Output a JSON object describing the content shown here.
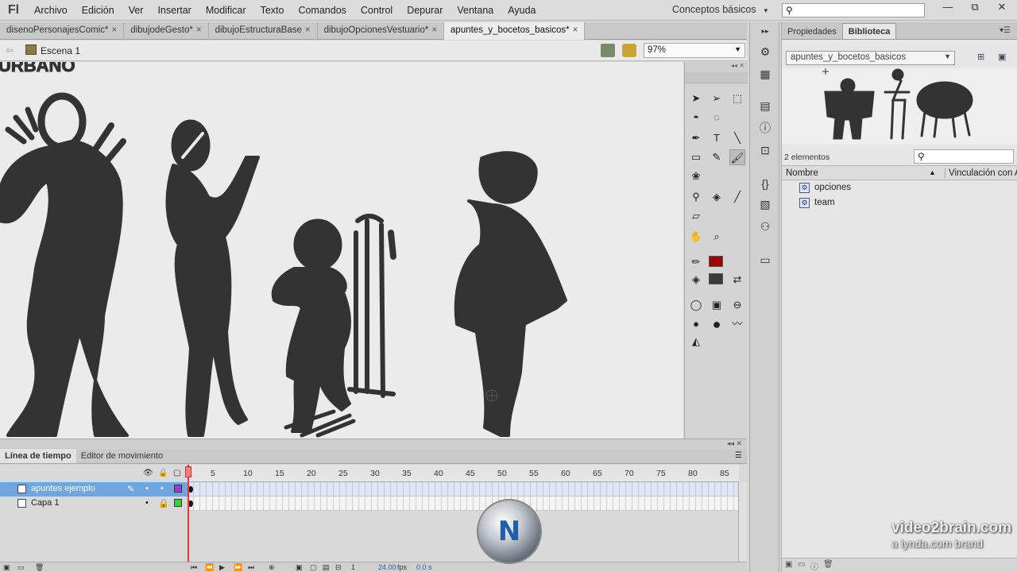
{
  "app": {
    "logo": "Fl"
  },
  "menu": [
    "Archivo",
    "Edición",
    "Ver",
    "Insertar",
    "Modificar",
    "Texto",
    "Comandos",
    "Control",
    "Depurar",
    "Ventana",
    "Ayuda"
  ],
  "workspace": {
    "label": "Conceptos básicos"
  },
  "window_controls": {
    "minimize": "—",
    "restore": "⧉",
    "close": "✕"
  },
  "doc_tabs": [
    {
      "label": "disenoPersonajesComic*"
    },
    {
      "label": "dibujodeGesto*"
    },
    {
      "label": "dibujoEstructuraBase"
    },
    {
      "label": "dibujoOpcionesVestuario*"
    },
    {
      "label": "apuntes_y_bocetos_basicos*"
    }
  ],
  "scene": {
    "label": "Escena 1",
    "zoom": "97%"
  },
  "stage": {
    "partial_text": "URBANO"
  },
  "colors": {
    "stroke": "#3a3a3a",
    "fill": "#a00000",
    "accent": "#6fa6e0",
    "playhead": "#e33333",
    "sketch": "#333333"
  },
  "library": {
    "tabs": [
      {
        "label": "Propiedades"
      },
      {
        "label": "Biblioteca"
      }
    ],
    "document": "apuntes_y_bocetos_basicos",
    "count": "2 elementos",
    "columns": {
      "name": "Nombre",
      "link": "Vinculación con A"
    },
    "items": [
      {
        "label": "opciones"
      },
      {
        "label": "team"
      }
    ]
  },
  "timeline": {
    "tabs": [
      {
        "label": "Línea de tiempo"
      },
      {
        "label": "Editor de movimiento"
      }
    ],
    "ticks": [
      "1",
      "5",
      "10",
      "15",
      "20",
      "25",
      "30",
      "35",
      "40",
      "45",
      "50",
      "55",
      "60",
      "65",
      "70",
      "75",
      "80",
      "85"
    ],
    "layers": [
      {
        "name": "apuntes ejemplo",
        "selected": true
      },
      {
        "name": "Capa 1",
        "selected": false
      }
    ],
    "current_frame": "1",
    "fps": "24.00",
    "fps_unit": "fps",
    "time": "0.0 s"
  },
  "watermark": {
    "main": "video2brain.com",
    "sub": "a lynda.com brand"
  }
}
